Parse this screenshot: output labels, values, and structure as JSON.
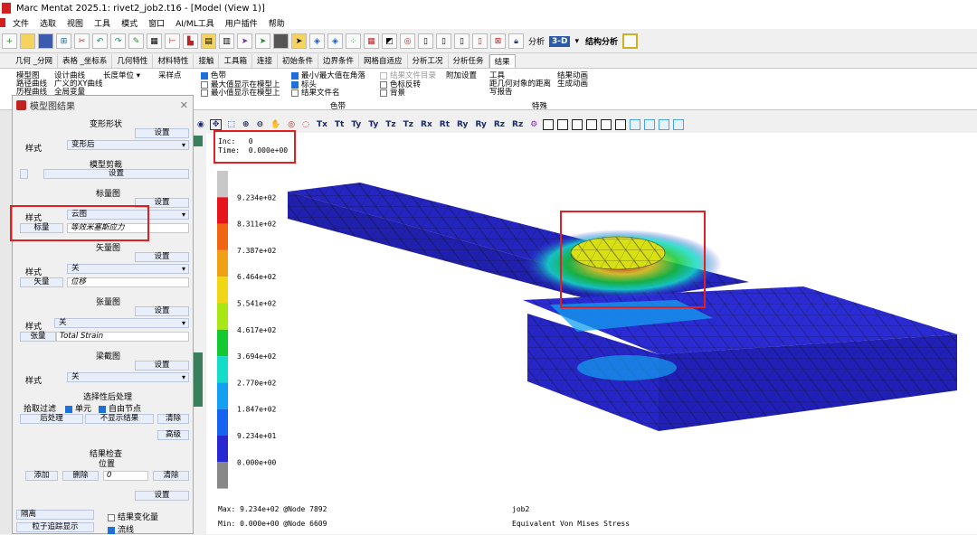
{
  "window": {
    "title": "Marc Mentat 2025.1: rivet2_job2.t16 - [Model (View 1)]"
  },
  "menu": [
    "文件",
    "选取",
    "视图",
    "工具",
    "模式",
    "窗口",
    "AI/ML工具",
    "用户插件",
    "帮助"
  ],
  "toolbar": {
    "analysis_label": "分析",
    "view_3d_label": "3-D",
    "structural_label": "结构分析"
  },
  "tabs": [
    "几何 _分网",
    "表格 _坐标系",
    "几何特性",
    "材料特性",
    "接触",
    "工具箱",
    "连接",
    "初始条件",
    "边界条件",
    "网格自适应",
    "分析工况",
    "分析任务",
    "结果"
  ],
  "active_tab": "结果",
  "ribbon": {
    "col1": [
      "模型图",
      "路径曲线",
      "历程曲线"
    ],
    "col2": [
      "设计曲线",
      "广义的XY曲线",
      "全局变量"
    ],
    "length_unit": "长度单位",
    "sample_point": "采样点",
    "checks_a": [
      {
        "label": "色带",
        "checked": true
      },
      {
        "label": "最大值显示在模型上",
        "checked": false
      },
      {
        "label": "最小值显示在模型上",
        "checked": false
      }
    ],
    "checks_b": [
      {
        "label": "最小/最大值在角落",
        "checked": true
      },
      {
        "label": "标头",
        "checked": true
      },
      {
        "label": "结果文件名",
        "checked": false
      }
    ],
    "checks_c": [
      {
        "label": "结果文件目录",
        "checked": false,
        "disabled": true
      },
      {
        "label": "色标反转",
        "checked": false
      },
      {
        "label": "背景",
        "checked": false
      }
    ],
    "add_settings": "附加设置",
    "group_colorbar": "色带",
    "tools_title": "工具",
    "tools": [
      "距几何对象的距离",
      "写报告"
    ],
    "result_anim": "结果动画",
    "gen_anim": "生成动画",
    "group_special": "特殊"
  },
  "view_toolbar": [
    "Tx",
    "Tt",
    "Ty",
    "Ty",
    "Tz",
    "Tz",
    "Rx",
    "Rt",
    "Ry",
    "Ry",
    "Rz",
    "Rz"
  ],
  "panel": {
    "title": "模型图结果",
    "deform_section": "变形形状",
    "settings": "设置",
    "style_label": "样式",
    "deform_style": "变形后",
    "clip_section": "模型剪裁",
    "scalar_section": "标量图",
    "scalar_style": "云图",
    "scalar_button": "标量",
    "scalar_value": "等效米塞斯应力",
    "vector_section": "矢量图",
    "vector_style": "关",
    "vector_button": "矢量",
    "vector_value": "位移",
    "tensor_section": "张量图",
    "tensor_style": "关",
    "tensor_button": "张量",
    "tensor_value": "Total Strain",
    "beam_section": "梁截图",
    "beam_style": "关",
    "post_section": "选择性后处理",
    "pick_filter": "拾取过滤",
    "element_label": "单元",
    "free_node_label": "自由节点",
    "post_btn": "后处理",
    "hide_btn": "不显示结果",
    "clear_btn": "清除",
    "advanced_btn": "高级",
    "check_section": "结果检查",
    "location_label": "位置",
    "add_btn": "添加",
    "delete_btn": "删除",
    "location_value": "0",
    "clear2_btn": "清除",
    "isolate_label": "隔离",
    "result_change": "结果变化量",
    "particle_btn": "粒子追踪显示",
    "streamline_label": "流线"
  },
  "viewport": {
    "inc_label": "Inc:",
    "inc_value": "0",
    "time_label": "Time:",
    "time_value": "0.000e+00",
    "max_text": "Max:   9.234e+02 @Node   7892",
    "min_text": "Min:   0.000e+00 @Node   6609",
    "job_name": "job2",
    "result_name": "Equivalent Von Mises Stress"
  },
  "legend": {
    "values": [
      "9.234e+02",
      "8.311e+02",
      "7.387e+02",
      "6.464e+02",
      "5.541e+02",
      "4.617e+02",
      "3.694e+02",
      "2.770e+02",
      "1.847e+02",
      "9.234e+01",
      "0.000e+00"
    ],
    "colors": [
      "#c8c8c8",
      "#e8141c",
      "#f06414",
      "#f0a014",
      "#f0d614",
      "#a8e614",
      "#14c832",
      "#14dcc8",
      "#14a0f0",
      "#1464f0",
      "#2828d2",
      "#888888"
    ]
  },
  "colors": {
    "accent": "#1e6fd9",
    "highlight_box": "#e02020",
    "mesh_blue": "#2b2bd6"
  }
}
